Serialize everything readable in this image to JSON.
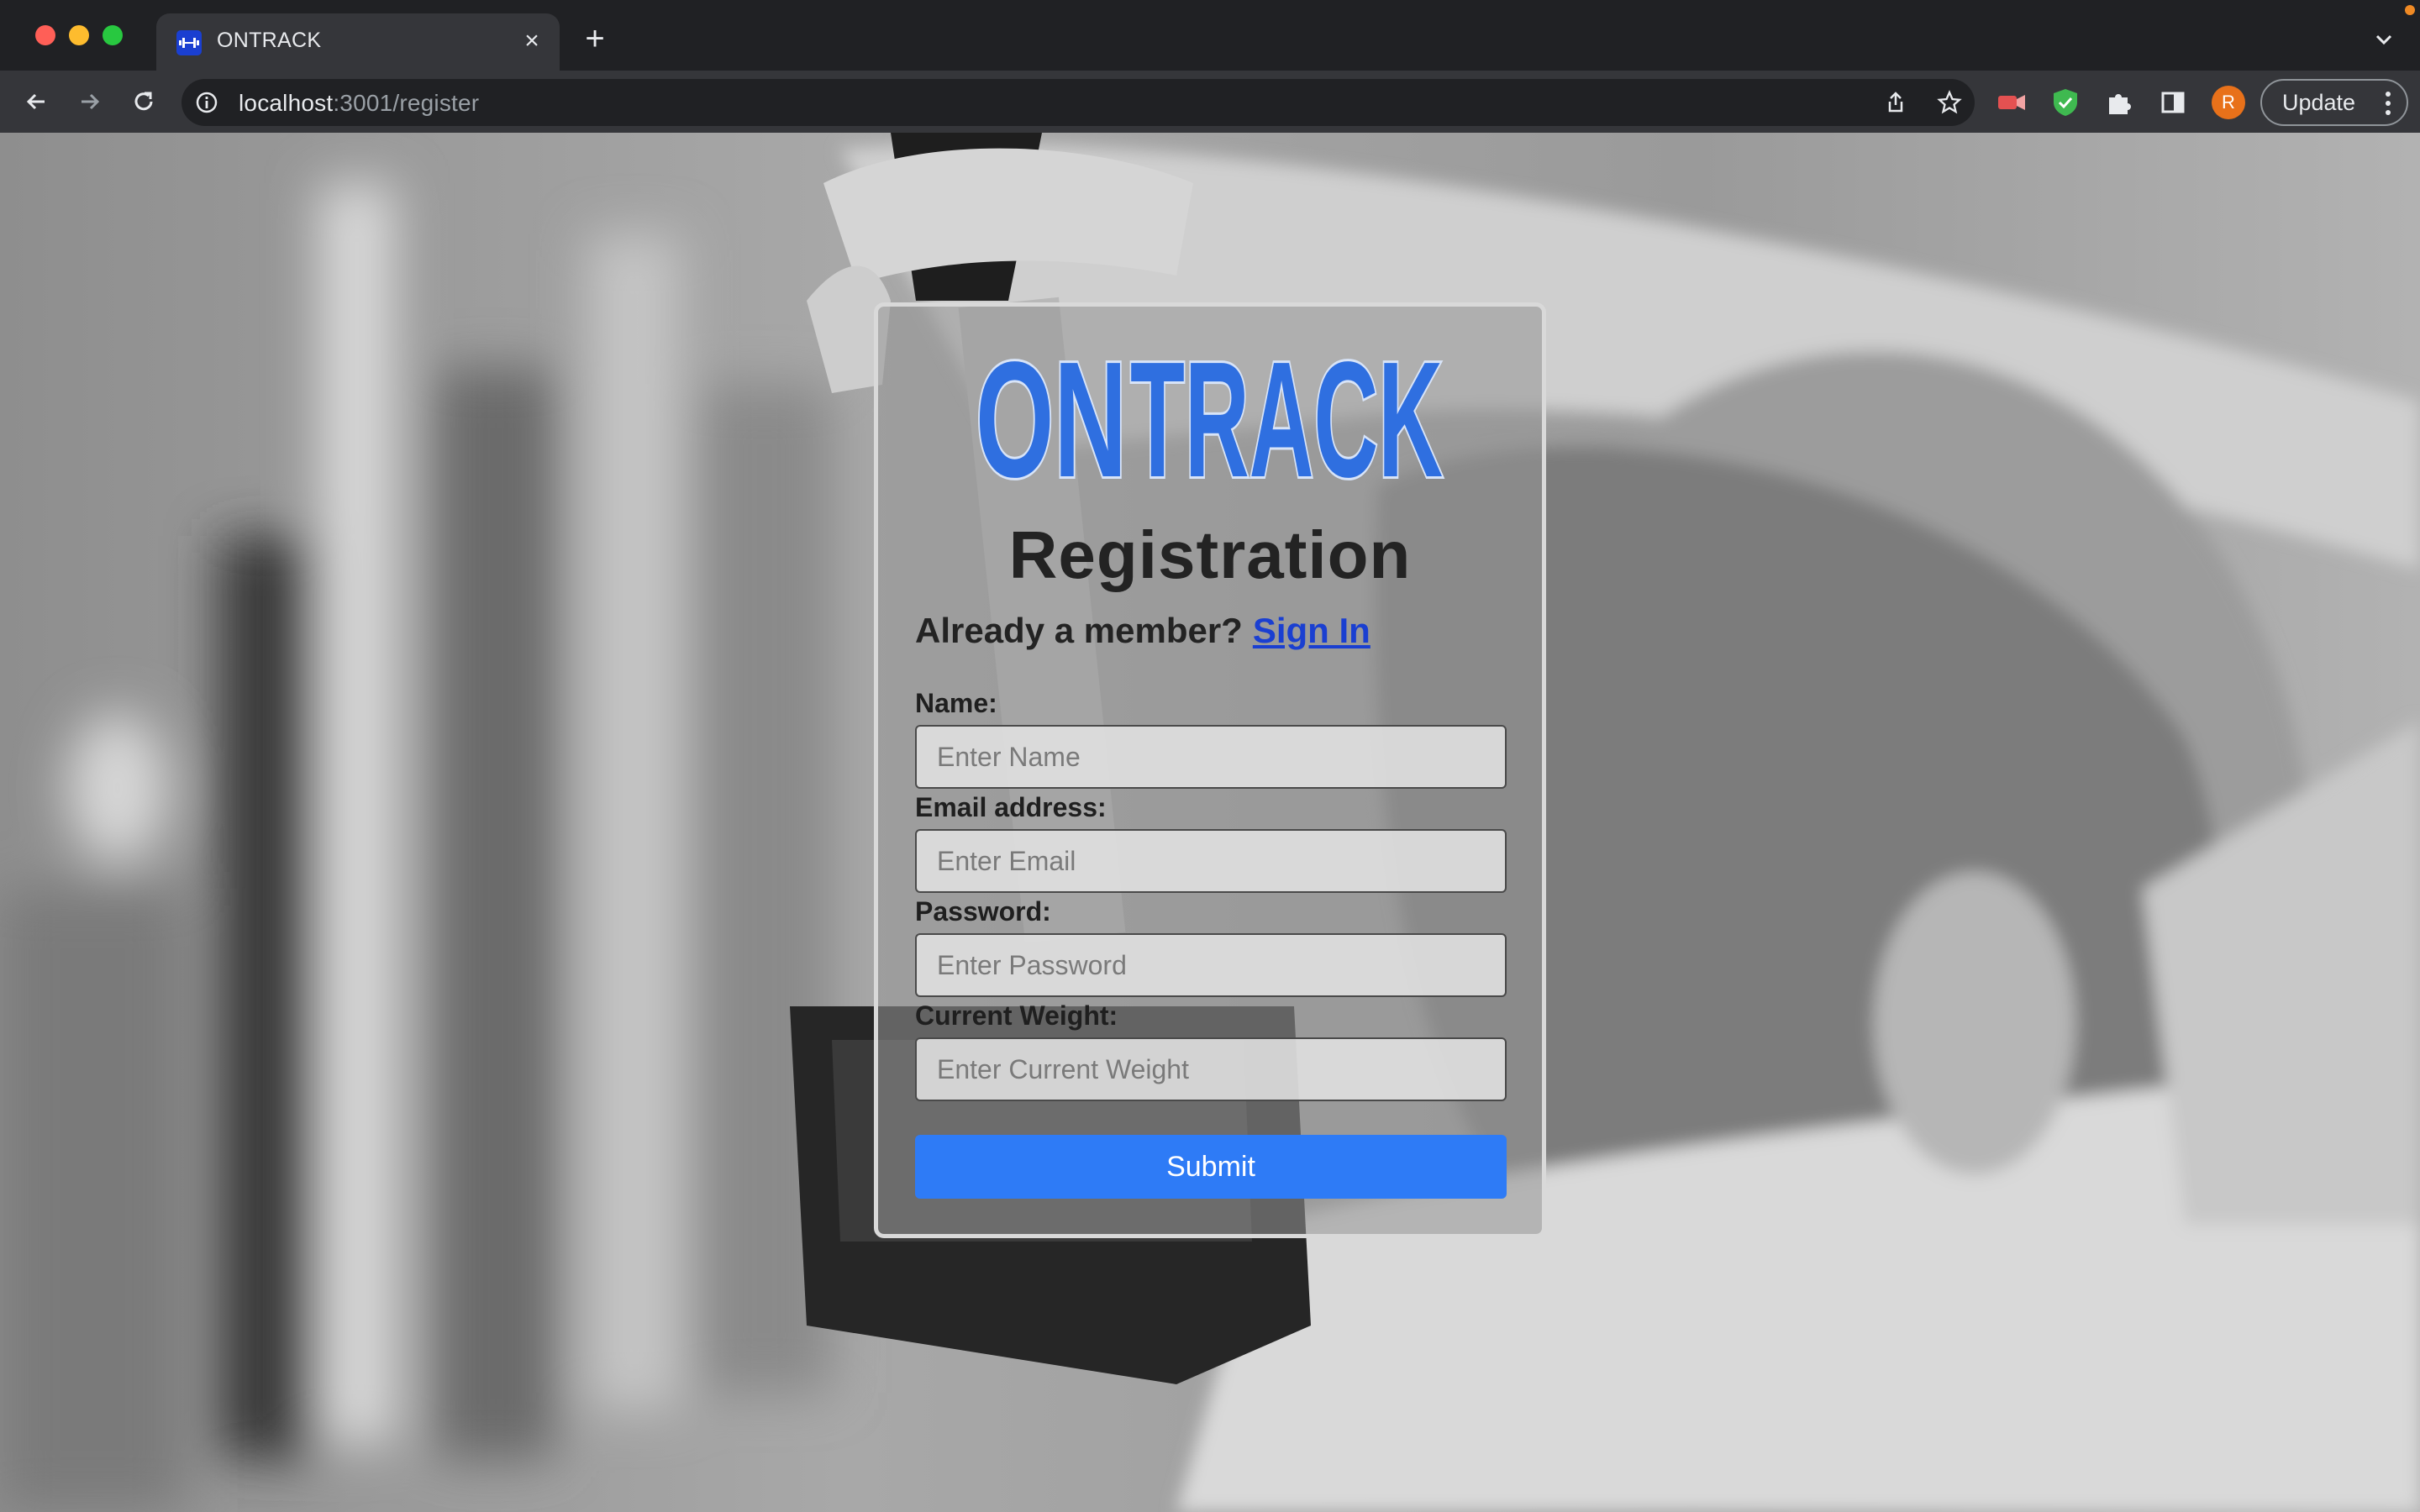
{
  "browser": {
    "tab_title": "ONTRACK",
    "url_host": "localhost",
    "url_path": ":3001/register",
    "update_label": "Update",
    "avatar_initial": "R"
  },
  "page": {
    "logo_text_on": "ON",
    "logo_text_track": "TRACK",
    "title": "Registration",
    "member_prompt": "Already a member?",
    "sign_in_label": "Sign In",
    "fields": [
      {
        "label": "Name:",
        "placeholder": "Enter Name"
      },
      {
        "label": "Email address:",
        "placeholder": "Enter Email"
      },
      {
        "label": "Password:",
        "placeholder": "Enter Password"
      },
      {
        "label": "Current Weight:",
        "placeholder": "Enter Current Weight"
      }
    ],
    "submit_label": "Submit"
  },
  "colors": {
    "accent_blue": "#2e7bf6",
    "link_blue": "#1a3fd1",
    "logo_blue": "#2f6fe0"
  },
  "icons": [
    "dumbbell-icon",
    "close-icon",
    "plus-icon",
    "chevron-down-icon",
    "back-arrow-icon",
    "forward-arrow-icon",
    "reload-icon",
    "info-icon",
    "share-icon",
    "star-icon",
    "extension-icon",
    "shield-icon",
    "puzzle-icon",
    "sidebar-icon",
    "more-vert-icon"
  ]
}
